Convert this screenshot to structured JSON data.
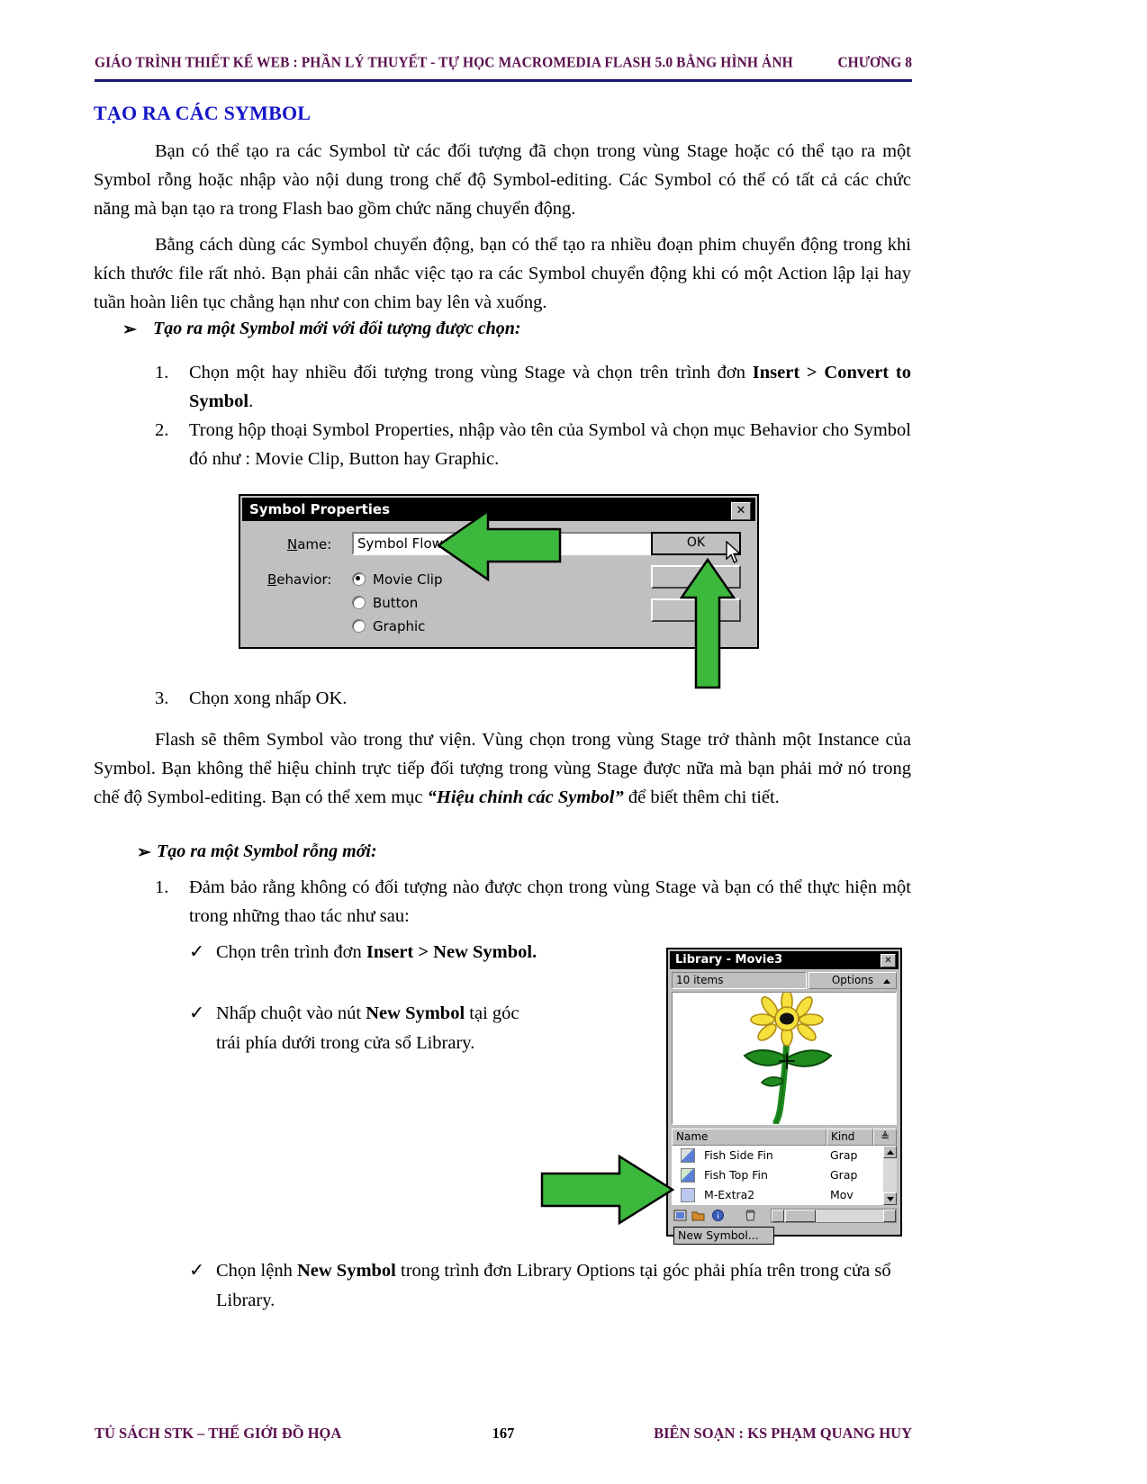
{
  "header": {
    "title": "GIÁO TRÌNH THIẾT KẾ WEB : PHẦN LÝ THUYẾT - TỰ HỌC MACROMEDIA FLASH 5.0 BẰNG HÌNH ẢNH",
    "chapter": "CHƯƠNG 8",
    "rule_color": "#1a1a6e",
    "text_color": "#5B0F4E"
  },
  "section": {
    "title": "TẠO RA CÁC SYMBOL",
    "title_color": "#1414c8"
  },
  "paragraphs": {
    "p1_a": "Bạn có thể tạo ra các Symbol từ các đối tượng đã chọn trong vùng Stage hoặc có thể tạo ra một Symbol rỗng hoặc nhập vào nội dung trong chế độ Symbol-editing.  Các Symbol có thể có tất cả các chức năng mà bạn tạo ra trong Flash bao gồm chức năng chuyển động.",
    "p2": "Bằng cách dùng các Symbol chuyển động, bạn có thể tạo ra nhiều đoạn phim chuyển động trong khi kích thước file rất nhỏ. Bạn phải cân nhắc việc tạo ra các Symbol chuyển động khi có một Action lập lại hay tuần hoàn liên tục chẳng hạn như con chim bay lên và xuống.",
    "p3_a": "Flash sẽ thêm Symbol vào trong thư viện. Vùng chọn trong vùng Stage trở thành một Instance của Symbol. Bạn không thể hiệu chỉnh trực tiếp đối tượng trong vùng Stage được nữa mà bạn phải mở nó trong chế độ Symbol-editing.  Bạn có thể xem mục ",
    "p3_em": "“Hiệu chỉnh các Symbol”",
    "p3_b": " để biết thêm chi tiết."
  },
  "headings": {
    "h1_bullet": "➢",
    "h1": "Tạo ra một Symbol mới với đối tượng  được chọn:",
    "h2_bullet": "➢",
    "h2": "Tạo ra một Symbol rỗng mới:"
  },
  "list1": [
    {
      "num": "1.",
      "text_a": "Chọn một hay nhiều đối tượng trong vùng Stage và chọn trên trình đơn ",
      "bold": "Insert > Convert to Symbol",
      "text_b": "."
    },
    {
      "num": "2.",
      "text_a": "Trong hộp thoại Symbol Properties, nhập vào tên của Symbol và chọn mục Behavior cho Symbol đó như : Movie Clip, Button hay Graphic.",
      "bold": "",
      "text_b": ""
    },
    {
      "num": "3.",
      "text_a": "Chọn xong nhấp OK.",
      "bold": "",
      "text_b": ""
    }
  ],
  "list2": {
    "num": "1.",
    "text": "Đảm bảo rằng không có đối tượng nào được chọn trong vùng Stage và bạn có thể thực hiện một trong những thao tác như sau:"
  },
  "checks": [
    {
      "mark": "✓",
      "a": "Chọn trên trình đơn  ",
      "b": "Insert > New Symbol.",
      "c": ""
    },
    {
      "mark": "✓",
      "a": "Nhấp chuột vào nút ",
      "b": "New Symbol",
      "c": " tại góc trái phía dưới trong cửa sổ Library."
    },
    {
      "mark": "✓",
      "a": "Chọn lệnh ",
      "b": "New Symbol",
      "c": " trong trình đơn Library Options tại góc phải phía trên trong cửa sổ Library."
    }
  ],
  "symbol_dialog": {
    "title": "Symbol Properties",
    "close_label": "✕",
    "name_label": "Name:",
    "name_label_accel": "N",
    "name_value": "Symbol Flower",
    "behavior_label": "Behavior:",
    "behavior_label_accel": "B",
    "options": [
      {
        "label": "Movie Clip",
        "selected": true
      },
      {
        "label": "Button",
        "selected": false
      },
      {
        "label": "Graphic",
        "selected": false
      }
    ],
    "buttons": [
      {
        "label": "OK",
        "default": true
      },
      {
        "label": "",
        "default": false
      },
      {
        "label": "",
        "default": false
      }
    ]
  },
  "library_window": {
    "title": "Library - Movie3",
    "close_label": "✕",
    "item_count": "10 items",
    "options_label": "Options",
    "columns": [
      "Name",
      "Kind",
      "≜"
    ],
    "rows": [
      {
        "name": "Fish Side Fin",
        "kind": "Grap"
      },
      {
        "name": "Fish Top Fin",
        "kind": "Grap"
      },
      {
        "name": "M-Extra2",
        "kind": "Mov"
      }
    ],
    "tooltip": "New Symbol..."
  },
  "footer": {
    "left": "TỦ SÁCH STK – THẾ GIỚI ĐỒ HỌA",
    "page": "167",
    "right": "BIÊN SOẠN : KS PHẠM QUANG HUY"
  },
  "colors": {
    "arrow_green": "#3cb83c",
    "dialog_face": "#c0c0c0",
    "flower_petal": "#f5e03c",
    "flower_stem": "#1f8b1f"
  }
}
